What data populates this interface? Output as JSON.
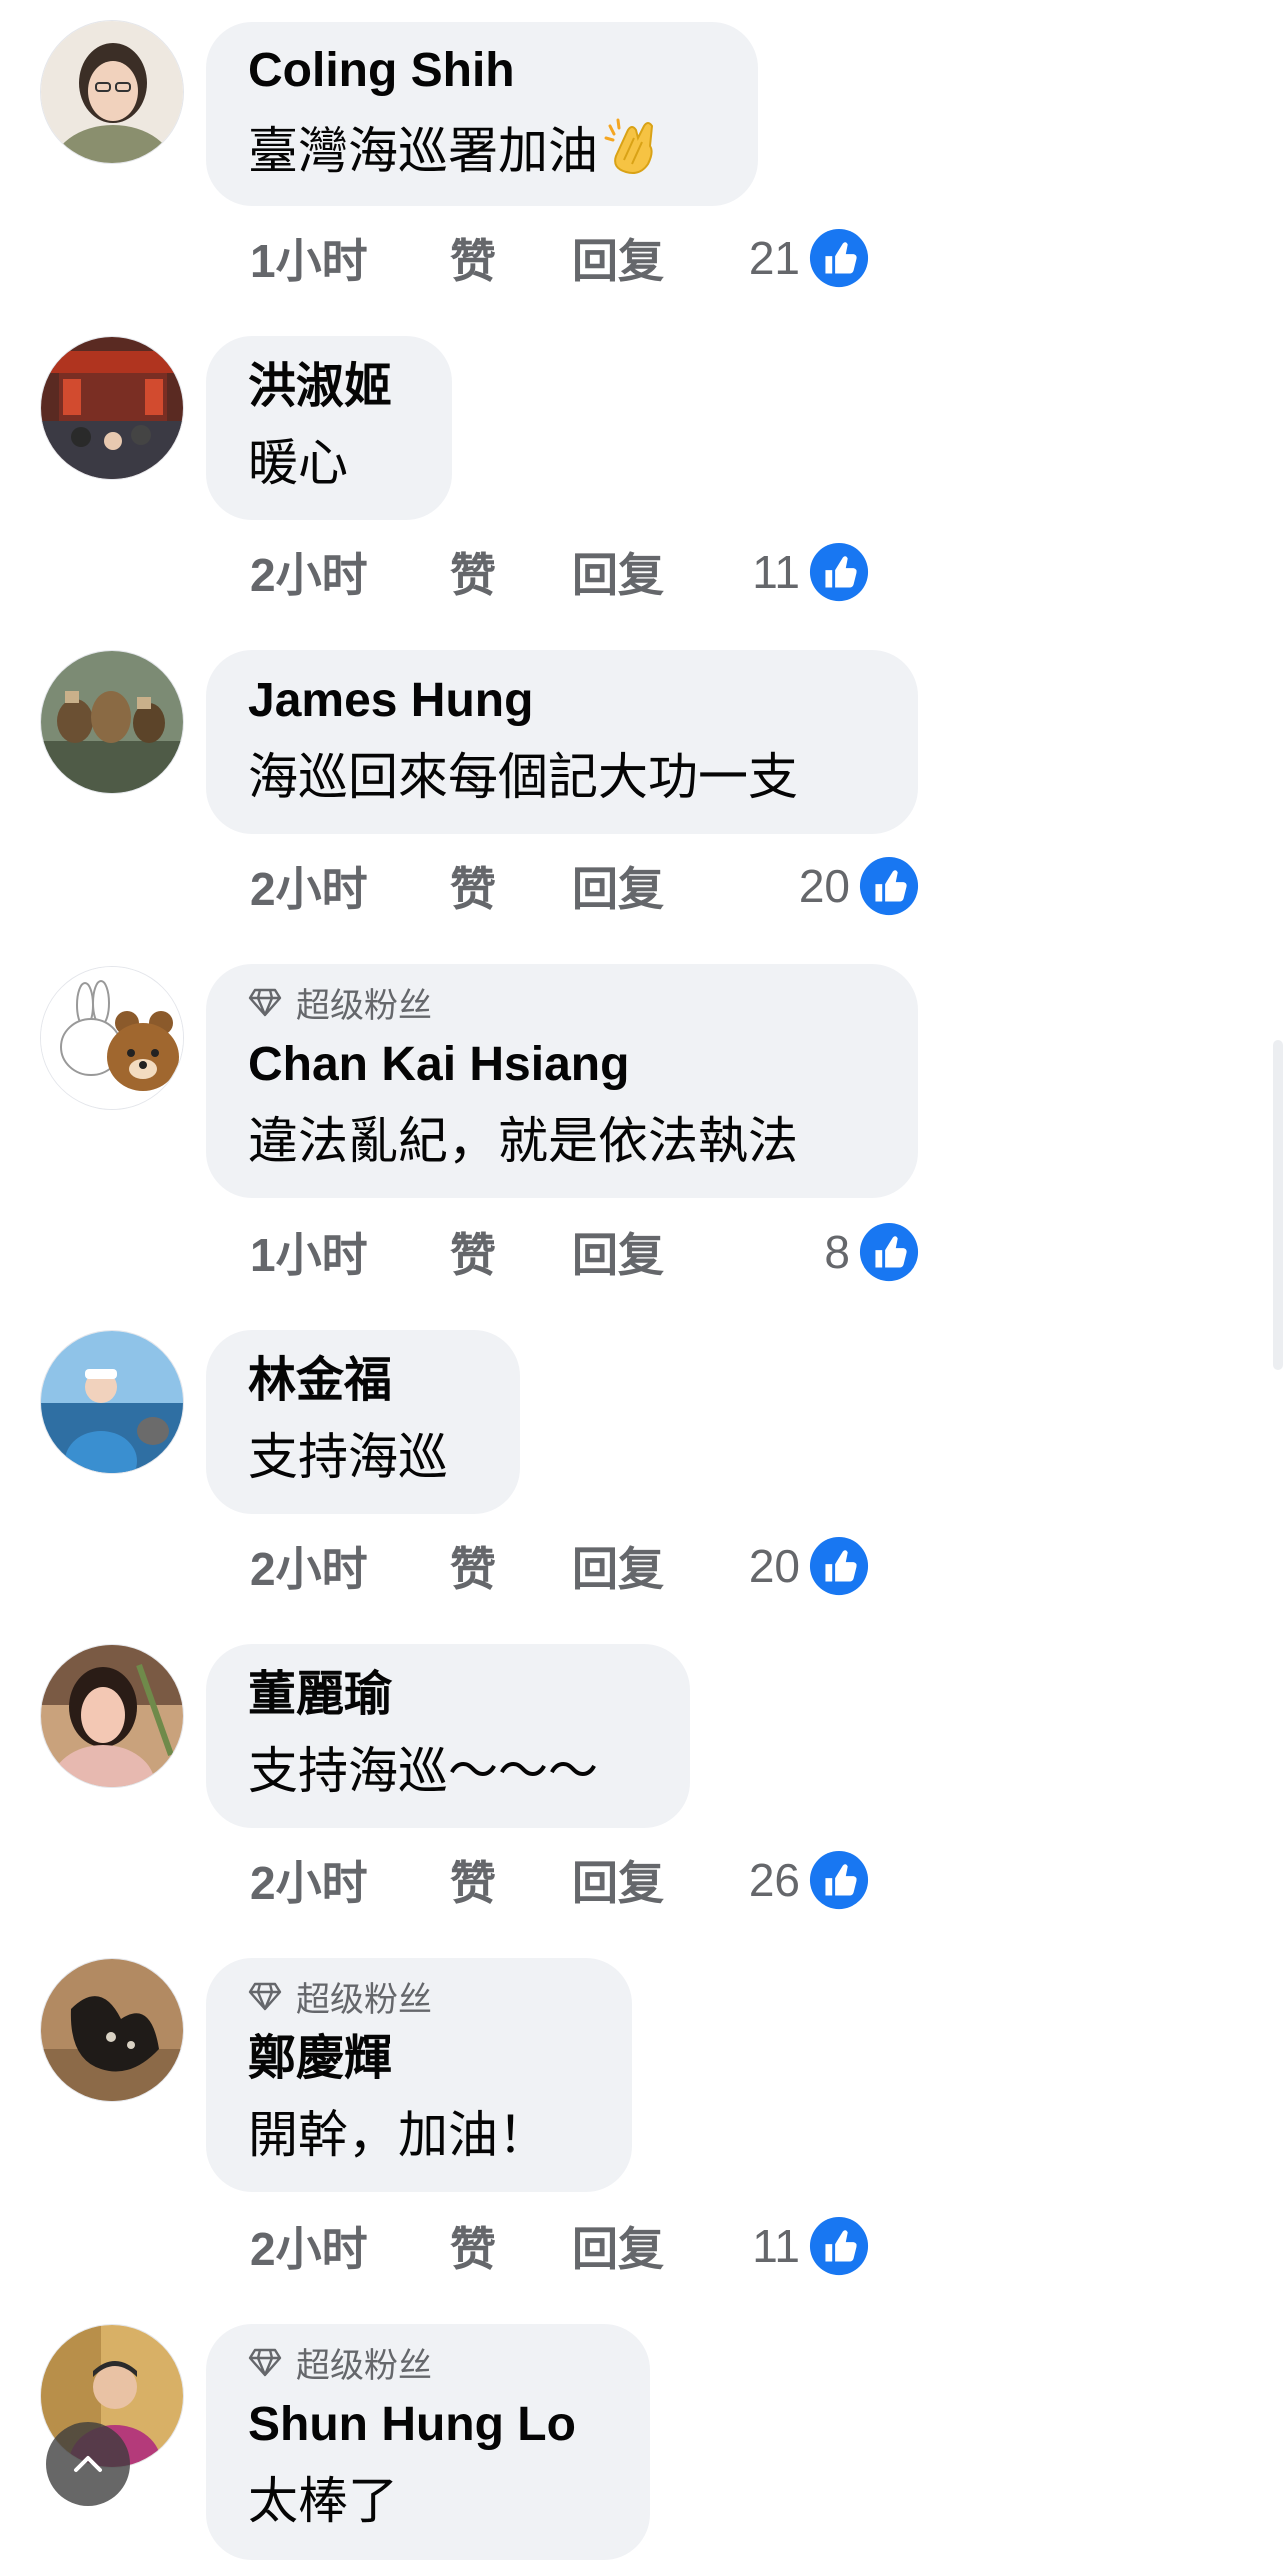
{
  "labels": {
    "like": "赞",
    "reply": "回复",
    "top_fan_badge": "超级粉丝"
  },
  "colors": {
    "bubble": "#f0f2f5",
    "meta_text": "#65676b",
    "like_blue": "#1877f2"
  },
  "icons": {
    "reaction": "thumbs-up-icon",
    "badge": "diamond-icon",
    "scroll": "chevron-up-icon",
    "emoji": "clapping-hands-emoji"
  },
  "comments": [
    {
      "author": "Coling Shih",
      "text": "臺灣海巡署加油",
      "emoji": "👏",
      "time": "1小时",
      "reactions": "21",
      "top_fan": false
    },
    {
      "author": "洪淑姬",
      "text": "暖心",
      "time": "2小时",
      "reactions": "11",
      "top_fan": false
    },
    {
      "author": "James Hung",
      "text": "海巡回來每個記大功一支",
      "time": "2小时",
      "reactions": "20",
      "top_fan": false
    },
    {
      "author": "Chan Kai Hsiang",
      "text": "違法亂紀，就是依法執法",
      "time": "1小时",
      "reactions": "8",
      "top_fan": true
    },
    {
      "author": "林金福",
      "text": "支持海巡",
      "time": "2小时",
      "reactions": "20",
      "top_fan": false
    },
    {
      "author": "董麗瑜",
      "text": "支持海巡～～～",
      "time": "2小时",
      "reactions": "26",
      "top_fan": false
    },
    {
      "author": "鄭慶輝",
      "text": "開幹，加油！",
      "time": "2小时",
      "reactions": "11",
      "top_fan": true
    },
    {
      "author": "Shun Hung Lo",
      "text": "太棒了",
      "top_fan": true
    }
  ]
}
